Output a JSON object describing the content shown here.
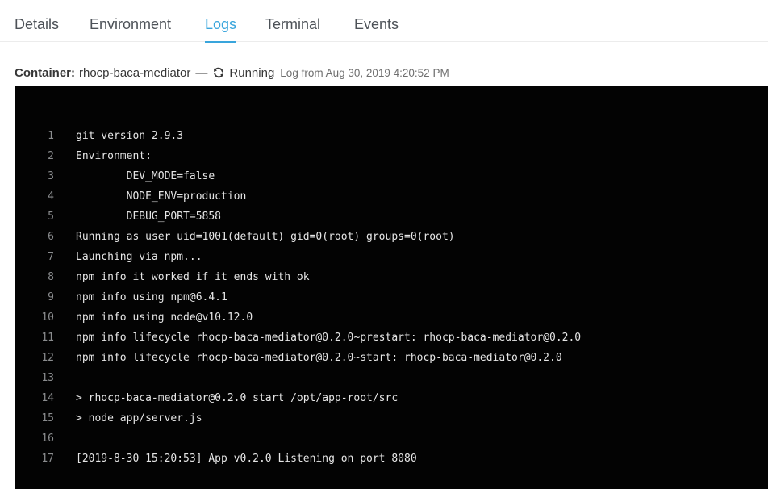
{
  "tabs": [
    {
      "label": "Details",
      "active": false
    },
    {
      "label": "Environment",
      "active": false
    },
    {
      "label": "Logs",
      "active": true
    },
    {
      "label": "Terminal",
      "active": false
    },
    {
      "label": "Events",
      "active": false
    }
  ],
  "status": {
    "container_label": "Container:",
    "container_name": "rhocp-baca-mediator",
    "separator": "—",
    "state_icon": "sync-icon",
    "state": "Running",
    "log_from": "Log from Aug 30, 2019 4:20:52 PM"
  },
  "colors": {
    "accent": "#39a5dc",
    "log_background": "#030303",
    "log_text": "#e5e5e5"
  },
  "log": {
    "lines": [
      {
        "n": "1",
        "text": "git version 2.9.3"
      },
      {
        "n": "2",
        "text": "Environment:"
      },
      {
        "n": "3",
        "text": "        DEV_MODE=false"
      },
      {
        "n": "4",
        "text": "        NODE_ENV=production"
      },
      {
        "n": "5",
        "text": "        DEBUG_PORT=5858"
      },
      {
        "n": "6",
        "text": "Running as user uid=1001(default) gid=0(root) groups=0(root)"
      },
      {
        "n": "7",
        "text": "Launching via npm..."
      },
      {
        "n": "8",
        "text": "npm info it worked if it ends with ok"
      },
      {
        "n": "9",
        "text": "npm info using npm@6.4.1"
      },
      {
        "n": "10",
        "text": "npm info using node@v10.12.0"
      },
      {
        "n": "11",
        "text": "npm info lifecycle rhocp-baca-mediator@0.2.0~prestart: rhocp-baca-mediator@0.2.0"
      },
      {
        "n": "12",
        "text": "npm info lifecycle rhocp-baca-mediator@0.2.0~start: rhocp-baca-mediator@0.2.0"
      },
      {
        "n": "13",
        "text": ""
      },
      {
        "n": "14",
        "text": "> rhocp-baca-mediator@0.2.0 start /opt/app-root/src"
      },
      {
        "n": "15",
        "text": "> node app/server.js"
      },
      {
        "n": "16",
        "text": ""
      },
      {
        "n": "17",
        "text": "[2019-8-30 15:20:53] App v0.2.0 Listening on port 8080"
      }
    ]
  }
}
